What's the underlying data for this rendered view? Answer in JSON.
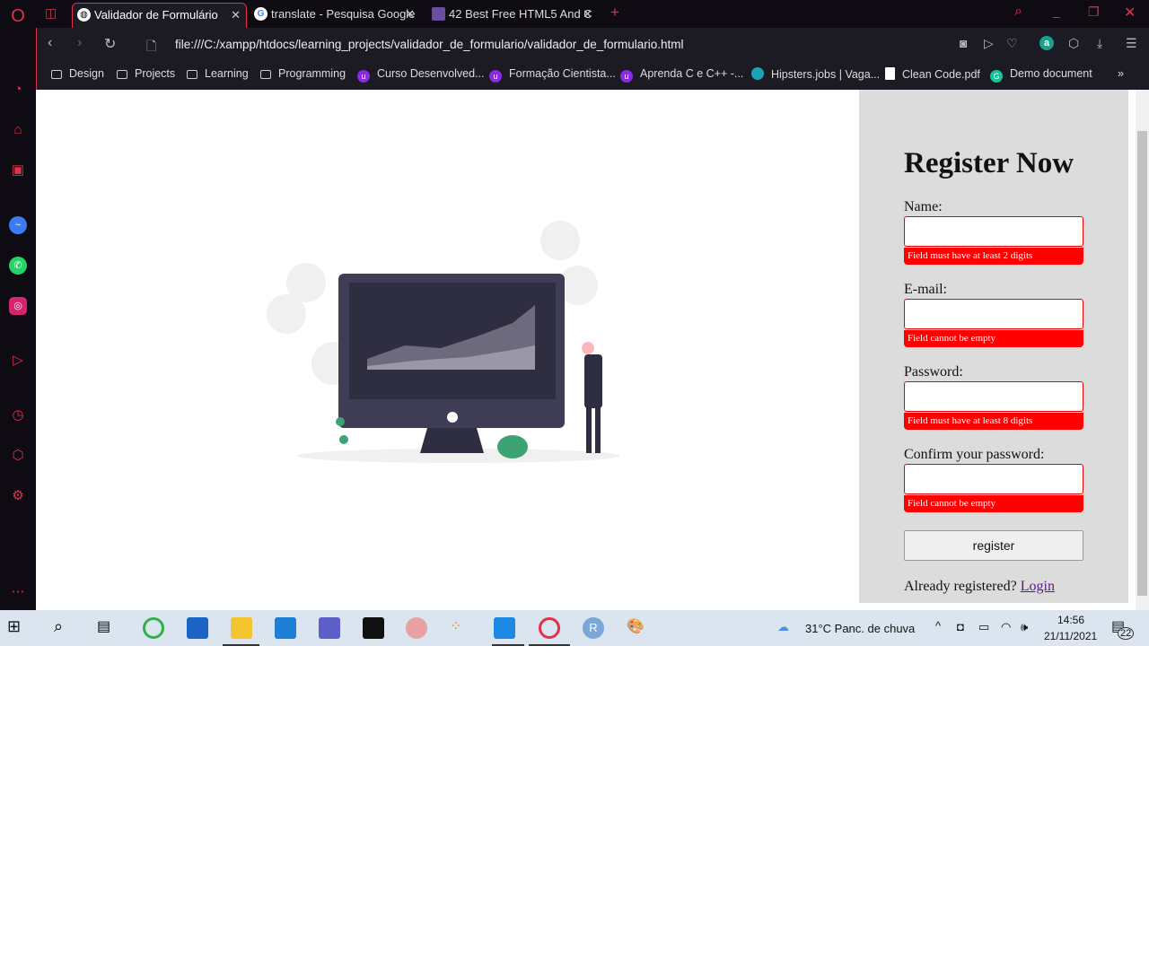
{
  "browser": {
    "tabs": [
      {
        "title": "Validador de Formulário",
        "active": true
      },
      {
        "title": "translate - Pesquisa Google",
        "active": false
      },
      {
        "title": "42 Best Free HTML5 And C",
        "active": false
      }
    ],
    "new_tab": "+",
    "url": "file:///C:/xampp/htdocs/learning_projects/validador_de_formulario/validador_de_formulario.html",
    "bookmarks": [
      "Design",
      "Projects",
      "Learning",
      "Programming",
      "Curso Desenvolved...",
      "Formação Cientista...",
      "Aprenda C e C++ -...",
      "Hipsters.jobs | Vaga...",
      "Clean Code.pdf",
      "Demo document"
    ],
    "more": "»"
  },
  "form": {
    "title": "Register Now",
    "fields": [
      {
        "label": "Name:",
        "value": "",
        "error": "Field must have at least 2 digits"
      },
      {
        "label": "E-mail:",
        "value": "",
        "error": "Field cannot be empty"
      },
      {
        "label": "Password:",
        "value": "",
        "error": "Field must have at least 8 digits"
      },
      {
        "label": "Confirm your password:",
        "value": "",
        "error": "Field cannot be empty"
      }
    ],
    "submit": "register",
    "already": "Already registered?",
    "login": "Login"
  },
  "taskbar": {
    "weather": "31°C  Panc. de chuva",
    "time": "14:56",
    "date": "21/11/2021",
    "notifications": "22"
  },
  "colors": {
    "accent": "#e0314b",
    "error": "#ff0000",
    "panel": "#dcdcdc"
  }
}
